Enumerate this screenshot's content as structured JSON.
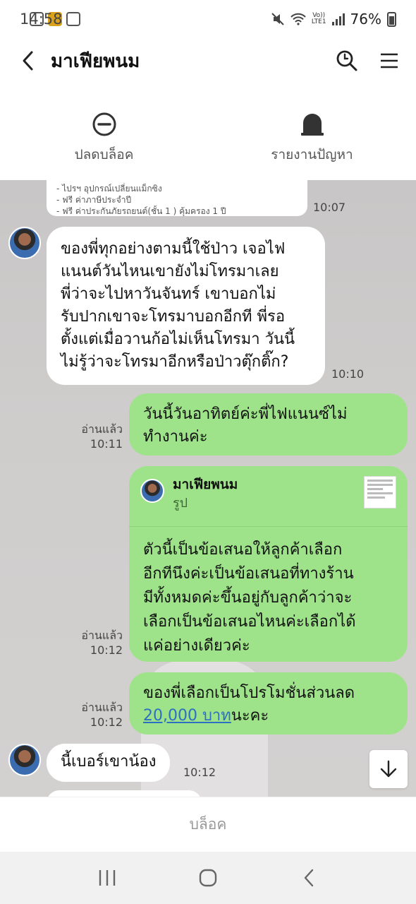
{
  "status_bar": {
    "time": "14:58",
    "battery": "76%",
    "net_top": "Vo))",
    "net_bottom": "LTE1"
  },
  "header": {
    "title": "มาเฟียพนม"
  },
  "actions": [
    {
      "label": "ปลดบล็อค",
      "icon": "unblock-icon"
    },
    {
      "label": "รายงานปัญหา",
      "icon": "report-icon"
    }
  ],
  "messages": {
    "image_partial": {
      "lines": [
        "- ไปรฯ อุปกรณ์เปลี่ยนแม็กซิง",
        "- ฟรี ค่าภาษีประจำปี",
        "- ฟรี ค่าประกันภัยรถยนต์(ชั้น 1 ) คุ้มครอง 1 ปี"
      ],
      "time": "10:07"
    },
    "incoming_1": {
      "lines": [
        "ของพี่ทุกอย่างตามนี้ใช้ป่าว เจอไฟ",
        "แนนต์วันไหนเขายังไม่โทรมาเลย",
        "พี่ว่าจะไปหาวันจันทร์ เขาบอกไม่",
        "รับปากเขาจะโทรมาบอกอีกที พี่รอ",
        "ตั้งแต่เมื่อวานก้อไม่เห็นโทรมา วันนี้",
        "ไม่รู้ว่าจะโทรมาอีกหรือป่าวตุ๊กติ๊ก?"
      ],
      "time": "10:10"
    },
    "outgoing_1": {
      "lines": [
        "วันนี้วันอาทิตย์ค่ะพี่ไฟแนนซ์ไม่",
        "ทำงานค่ะ"
      ],
      "read": "อ่านแล้ว",
      "time": "10:11"
    },
    "outgoing_2": {
      "quote_name": "มาเฟียพนม",
      "quote_sub": "รูป",
      "lines": [
        "ตัวนี้เป็นข้อเสนอให้ลูกค้าเลือก",
        "อีกทีนึงค่ะเป็นข้อเสนอที่ทางร้าน",
        "มีทั้งหมดค่ะขึ้นอยู่กับลูกค้าว่าจะ",
        "เลือกเป็นข้อเสนอไหนค่ะเลือกได้",
        "แค่อย่างเดียวค่ะ"
      ],
      "read": "อ่านแล้ว",
      "time": "10:12"
    },
    "outgoing_3": {
      "line1": "ของพี่เลือกเป็นโปรโมชั่นส่วนลด",
      "link": "20,000 บาท",
      "suffix": "นะคะ",
      "read": "อ่านแล้ว",
      "time": "10:12"
    },
    "incoming_2": {
      "text": "นี้เบอร์เขาน้อง",
      "time": "10:12"
    }
  },
  "footer": {
    "block_label": "บล็อค"
  },
  "colors": {
    "outgoing_bubble": "#9ee38a",
    "incoming_bubble": "#ffffff",
    "link": "#2d6fc2"
  }
}
